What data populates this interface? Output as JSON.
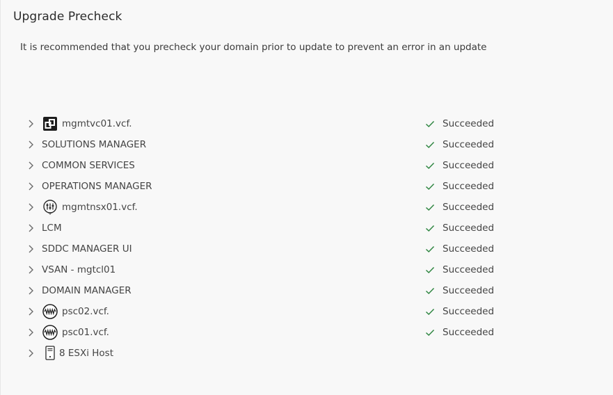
{
  "page": {
    "title": "Upgrade Precheck",
    "intro": "It is recommended that you precheck your domain prior to update to prevent an error in an update"
  },
  "colors": {
    "success": "#2e8540",
    "chevron": "#6b6b6b",
    "text": "#444444"
  },
  "items": [
    {
      "label": "mgmtvc01.vcf.",
      "icon": "vcenter-icon",
      "status": "Succeeded"
    },
    {
      "label": "SOLUTIONS MANAGER",
      "icon": null,
      "status": "Succeeded"
    },
    {
      "label": "COMMON SERVICES",
      "icon": null,
      "status": "Succeeded"
    },
    {
      "label": "OPERATIONS MANAGER",
      "icon": null,
      "status": "Succeeded"
    },
    {
      "label": "mgmtnsx01.vcf.",
      "icon": "nsx-icon",
      "status": "Succeeded"
    },
    {
      "label": "LCM",
      "icon": null,
      "status": "Succeeded"
    },
    {
      "label": "SDDC MANAGER UI",
      "icon": null,
      "status": "Succeeded"
    },
    {
      "label": "VSAN - mgtcl01",
      "icon": null,
      "status": "Succeeded"
    },
    {
      "label": "DOMAIN MANAGER",
      "icon": null,
      "status": "Succeeded"
    },
    {
      "label": "psc02.vcf.",
      "icon": "psc-icon",
      "status": "Succeeded"
    },
    {
      "label": "psc01.vcf.",
      "icon": "psc-icon",
      "status": "Succeeded"
    },
    {
      "label": "8 ESXi Host",
      "icon": "host-icon",
      "status": ""
    }
  ]
}
